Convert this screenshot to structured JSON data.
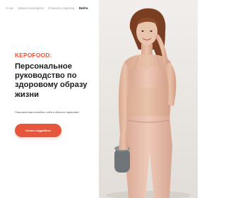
{
  "nav": {
    "items": [
      {
        "label": "О нас",
        "active": false
      },
      {
        "label": "Записи на вопросе",
        "active": false
      },
      {
        "label": "Отменить подписку",
        "active": false
      },
      {
        "label": "Войти",
        "active": true
      }
    ]
  },
  "hero": {
    "brand": "KEPOFOOD:",
    "headline": "Персональное руководство по здоровому образу жизни",
    "subtext": "Помогаем вам полюбить себя и обрести гармонию!",
    "cta_label": "Узнать подробнее"
  },
  "photo": {
    "subject": "woman-in-peach-sportswear-photo"
  },
  "colors": {
    "accent": "#e6563c",
    "brand_text": "#e8543a",
    "headline": "#1c1c1c",
    "photo_bg": "#ece8e4",
    "sportswear": "#e3b7a3"
  }
}
